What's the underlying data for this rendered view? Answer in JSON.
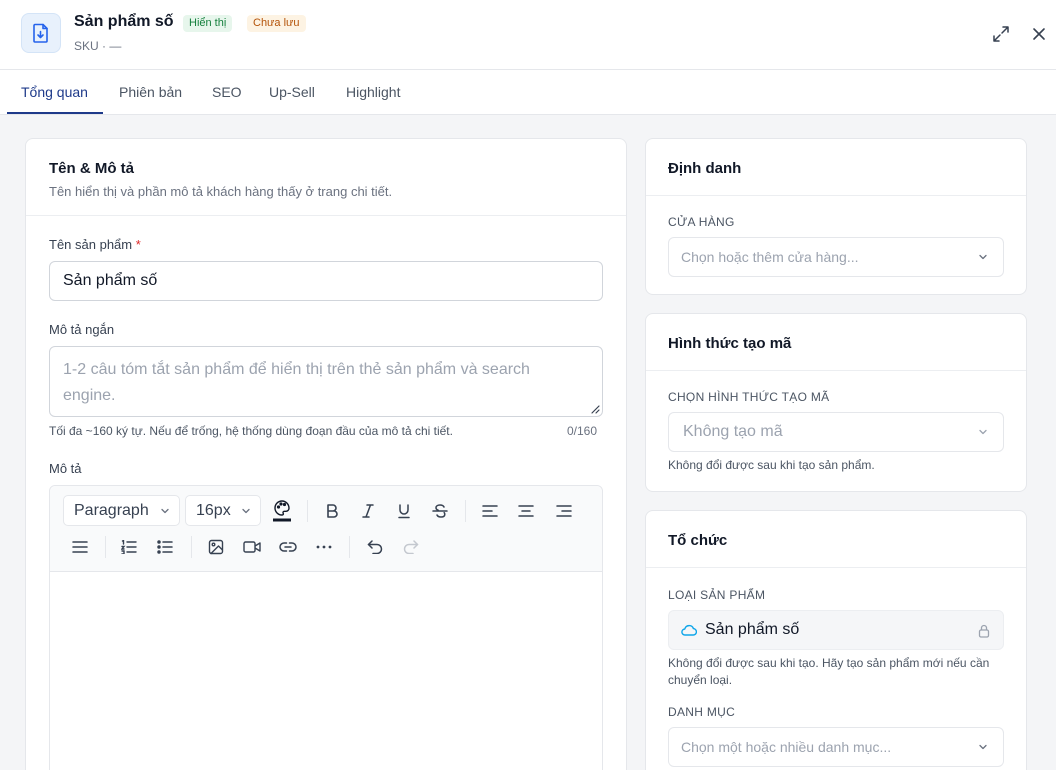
{
  "header": {
    "title": "Sản phẩm số",
    "badge_visible": "Hiển thị",
    "badge_unsaved": "Chưa lưu",
    "subtitle": "SKU · —",
    "product_icon": "download-file-icon",
    "expand_icon": "expand-icon",
    "close_icon": "close-icon"
  },
  "tabs": [
    {
      "label": "Tổng quan",
      "active": true
    },
    {
      "label": "Phiên bản"
    },
    {
      "label": "SEO"
    },
    {
      "label": "Up-Sell"
    },
    {
      "label": "Highlight"
    }
  ],
  "main": {
    "card_title": "Tên & Mô tả",
    "card_subtitle": "Tên hiển thị và phần mô tả khách hàng thấy ở trang chi tiết.",
    "name_label": "Tên sản phẩm",
    "required_mark": "*",
    "name_value": "Sản phẩm số",
    "short_desc_label": "Mô tả ngắn",
    "short_desc_placeholder": "1-2 câu tóm tắt sản phẩm để hiển thị trên thẻ sản phẩm và search engine.",
    "short_desc_help": "Tối đa ~160 ký tự. Nếu để trống, hệ thống dùng đoạn đầu của mô tả chi tiết.",
    "short_desc_count": "0/160",
    "desc_label": "Mô tả",
    "editor": {
      "block_format": "Paragraph",
      "font_size": "16px"
    }
  },
  "sidebar": {
    "identity": {
      "title": "Định danh",
      "store_label": "CỬA HÀNG",
      "store_placeholder": "Chọn hoặc thêm cửa hàng..."
    },
    "code_gen": {
      "title": "Hình thức tạo mã",
      "method_label": "CHỌN HÌNH THỨC TẠO MÃ",
      "method_value": "Không tạo mã",
      "method_help": "Không đổi được sau khi tạo sản phẩm."
    },
    "organization": {
      "title": "Tổ chức",
      "type_label": "LOẠI SẢN PHẨM",
      "type_value": "Sản phẩm số",
      "type_help": "Không đổi được sau khi tạo. Hãy tạo sản phẩm mới nếu cần chuyển loại.",
      "category_label": "DANH MỤC",
      "category_placeholder": "Chọn một hoặc nhiều danh mục..."
    }
  },
  "colors": {
    "accent": "#1e3a8a",
    "required": "#dc2626",
    "badge_green": "#15803d",
    "badge_orange": "#b45309",
    "cloud": "#0ea5e9"
  }
}
